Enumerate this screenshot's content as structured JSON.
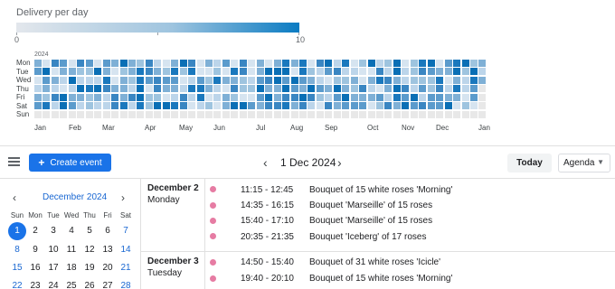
{
  "heatmap": {
    "title": "Delivery per day",
    "legend_min": "0",
    "legend_max": "10",
    "year": "2024",
    "day_labels": [
      "Mon",
      "Tue",
      "Wed",
      "Thu",
      "Fri",
      "Sat",
      "Sun"
    ],
    "month_labels": [
      "Jan",
      "Feb",
      "Mar",
      "Apr",
      "May",
      "Jun",
      "Jul",
      "Aug",
      "Sep",
      "Oct",
      "Nov",
      "Dec",
      "Jan"
    ],
    "colors": {
      "low": "#e3e7ec",
      "mid": "#9ec4df",
      "high": "#0a7bc2",
      "empty": "#e8e8e8"
    }
  },
  "toolbar": {
    "create_label": "Create event",
    "current_date": "1 Dec 2024",
    "today_label": "Today",
    "view_label": "Agenda"
  },
  "mini_calendar": {
    "month_label": "December 2024",
    "weekdays": [
      "Sun",
      "Mon",
      "Tue",
      "Wed",
      "Thu",
      "Fri",
      "Sat"
    ],
    "weeks": [
      [
        "1",
        "2",
        "3",
        "4",
        "5",
        "6",
        "7"
      ],
      [
        "8",
        "9",
        "10",
        "11",
        "12",
        "13",
        "14"
      ],
      [
        "15",
        "16",
        "17",
        "18",
        "19",
        "20",
        "21"
      ],
      [
        "22",
        "23",
        "24",
        "25",
        "26",
        "27",
        "28"
      ]
    ],
    "selected": "1"
  },
  "agenda": [
    {
      "date": "December 2",
      "weekday": "Monday",
      "events": [
        {
          "time": "11:15 - 12:45",
          "title": "Bouquet of 15 white roses 'Morning'"
        },
        {
          "time": "14:35 - 16:15",
          "title": "Bouquet 'Marseille' of 15 roses"
        },
        {
          "time": "15:40 - 17:10",
          "title": "Bouquet 'Marseille' of 15 roses"
        },
        {
          "time": "20:35 - 21:35",
          "title": "Bouquet 'Iceberg' of 17 roses"
        }
      ]
    },
    {
      "date": "December 3",
      "weekday": "Tuesday",
      "events": [
        {
          "time": "14:50 - 15:40",
          "title": "Bouquet of 31 white roses 'Icicle'"
        },
        {
          "time": "19:40 - 20:10",
          "title": "Bouquet of 15 white roses 'Morning'"
        }
      ]
    }
  ]
}
